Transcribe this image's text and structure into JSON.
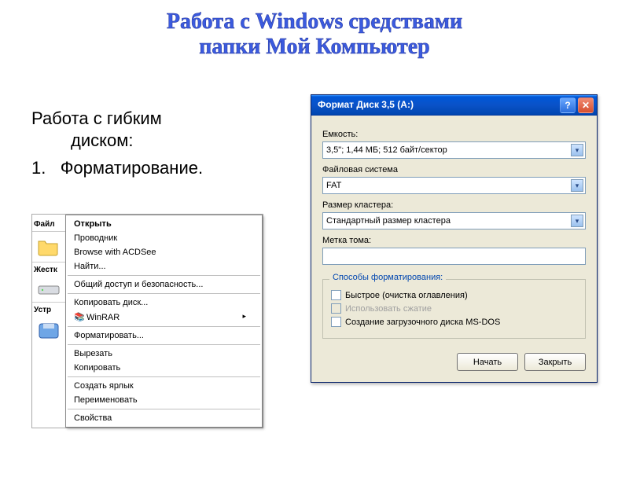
{
  "title_line1": "Работа с Windows средствами",
  "title_line2": "папки Мой Компьютер",
  "left": {
    "heading": "Работа с гибким",
    "heading2": "диском:",
    "item1_num": "1.",
    "item1_text": "Форматирование."
  },
  "ctx_left": {
    "files_label": "Файл",
    "hdd_label": "Жестк",
    "dev_label": "Устр"
  },
  "context_menu": {
    "open": "Открыть",
    "explorer": "Проводник",
    "acdsee": "Browse with ACDSee",
    "find": "Найти...",
    "share": "Общий доступ и безопасность...",
    "copy_disk": "Копировать диск...",
    "winrar": "WinRAR",
    "format": "Форматировать...",
    "cut": "Вырезать",
    "copy": "Копировать",
    "shortcut": "Создать ярлык",
    "rename": "Переименовать",
    "properties": "Свойства"
  },
  "dialog": {
    "title": "Формат Диск 3,5 (A:)",
    "capacity_label": "Емкость:",
    "capacity_value": "3,5\";  1,44 МБ; 512 байт/сектор",
    "filesystem_label": "Файловая система",
    "filesystem_value": "FAT",
    "cluster_label": "Размер кластера:",
    "cluster_value": "Стандартный размер кластера",
    "volume_label": "Метка тома:",
    "volume_value": "",
    "group_title": "Способы форматирования:",
    "quick": "Быстрое (очистка оглавления)",
    "compress": "Использовать сжатие",
    "bootdisk": "Создание загрузочного диска MS-DOS",
    "start_btn": "Начать",
    "close_btn": "Закрыть",
    "help_symbol": "?",
    "close_symbol": "✕"
  }
}
